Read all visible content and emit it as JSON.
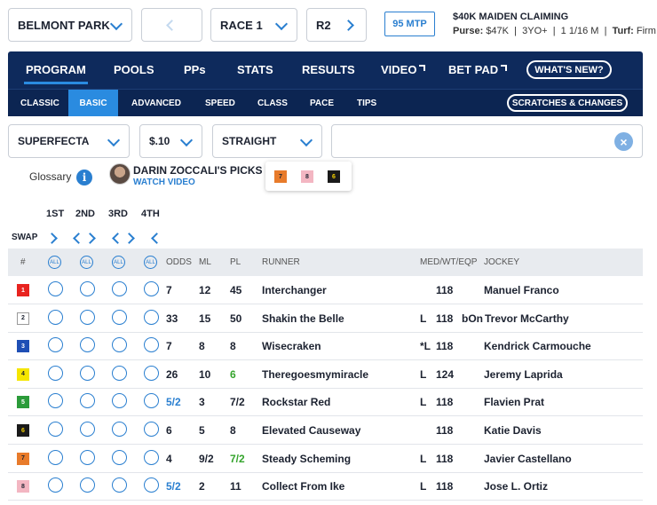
{
  "top": {
    "track": "BELMONT PARK",
    "race": "RACE 1",
    "race_short": "R2",
    "mtp": "95 MTP",
    "race_title": "$40K MAIDEN CLAIMING",
    "purse_label": "Purse:",
    "purse": "$47K",
    "age": "3YO+",
    "distance": "1 1/16 M",
    "turf_label": "Turf:",
    "turf": "Firm",
    "sep": "|"
  },
  "nav": {
    "tabs": [
      "PROGRAM",
      "POOLS",
      "PPs",
      "STATS",
      "RESULTS",
      "VIDEO",
      "BET PAD"
    ],
    "whats_new": "WHAT'S NEW?",
    "subtabs": [
      "CLASSIC",
      "BASIC",
      "ADVANCED",
      "SPEED",
      "CLASS",
      "PACE",
      "TIPS"
    ],
    "active_subtab": "BASIC",
    "scratches": "SCRATCHES & CHANGES"
  },
  "bet": {
    "type": "SUPERFECTA",
    "amount": "$.10",
    "mode": "STRAIGHT",
    "clear": "×"
  },
  "glossary": "Glossary",
  "info_glyph": "i",
  "picks": {
    "title": "DARIN ZOCCALI'S PICKS",
    "watch": "WATCH VIDEO",
    "selections": [
      {
        "num": "7",
        "bg": "#e87b2b",
        "fg": "#1c2230"
      },
      {
        "num": "8",
        "bg": "#f3b6c2",
        "fg": "#1c2230"
      },
      {
        "num": "6",
        "bg": "#1a1a1a",
        "fg": "#f4d000"
      }
    ]
  },
  "positions": [
    "1ST",
    "2ND",
    "3RD",
    "4TH"
  ],
  "swap": "SWAP",
  "table": {
    "headers": {
      "num": "#",
      "odds": "ODDS",
      "ml": "ML",
      "pl": "PL",
      "runner": "RUNNER",
      "med": "MED/WT/EQP",
      "jockey": "JOCKEY"
    },
    "all_label": "ALL",
    "rows": [
      {
        "num": "1",
        "bg": "#e8231f",
        "fg": "#ffffff",
        "border": "#e8231f",
        "odds": "7",
        "odds_blue": false,
        "ml": "12",
        "pl": "45",
        "pl_green": false,
        "runner": "Interchanger",
        "med": "",
        "wt": "118",
        "eqp": "",
        "jockey": "Manuel Franco"
      },
      {
        "num": "2",
        "bg": "#ffffff",
        "fg": "#1c2230",
        "border": "#999999",
        "odds": "33",
        "odds_blue": false,
        "ml": "15",
        "pl": "50",
        "pl_green": false,
        "runner": "Shakin the Belle",
        "med": "L",
        "wt": "118",
        "eqp": "bOn",
        "jockey": "Trevor McCarthy"
      },
      {
        "num": "3",
        "bg": "#1f4fb5",
        "fg": "#ffffff",
        "border": "#1f4fb5",
        "odds": "7",
        "odds_blue": false,
        "ml": "8",
        "pl": "8",
        "pl_green": false,
        "runner": "Wisecraken",
        "med": "*L",
        "wt": "118",
        "eqp": "",
        "jockey": "Kendrick Carmouche"
      },
      {
        "num": "4",
        "bg": "#f5e600",
        "fg": "#1c2230",
        "border": "#f5e600",
        "odds": "26",
        "odds_blue": false,
        "ml": "10",
        "pl": "6",
        "pl_green": true,
        "runner": "Theregoesmymiracle",
        "med": "L",
        "wt": "124",
        "eqp": "",
        "jockey": "Jeremy Laprida"
      },
      {
        "num": "5",
        "bg": "#2b9b3a",
        "fg": "#ffffff",
        "border": "#2b9b3a",
        "odds": "5/2",
        "odds_blue": true,
        "ml": "3",
        "pl": "7/2",
        "pl_green": false,
        "runner": "Rockstar Red",
        "med": "L",
        "wt": "118",
        "eqp": "",
        "jockey": "Flavien Prat"
      },
      {
        "num": "6",
        "bg": "#1a1a1a",
        "fg": "#f4d000",
        "border": "#1a1a1a",
        "odds": "6",
        "odds_blue": false,
        "ml": "5",
        "pl": "8",
        "pl_green": false,
        "runner": "Elevated Causeway",
        "med": "",
        "wt": "118",
        "eqp": "",
        "jockey": "Katie Davis"
      },
      {
        "num": "7",
        "bg": "#e87b2b",
        "fg": "#1c2230",
        "border": "#e87b2b",
        "odds": "4",
        "odds_blue": false,
        "ml": "9/2",
        "pl": "7/2",
        "pl_green": true,
        "runner": "Steady Scheming",
        "med": "L",
        "wt": "118",
        "eqp": "",
        "jockey": "Javier Castellano"
      },
      {
        "num": "8",
        "bg": "#f3b6c2",
        "fg": "#1c2230",
        "border": "#f3b6c2",
        "odds": "5/2",
        "odds_blue": true,
        "ml": "2",
        "pl": "11",
        "pl_green": false,
        "runner": "Collect From Ike",
        "med": "L",
        "wt": "118",
        "eqp": "",
        "jockey": "Jose L. Ortiz"
      }
    ]
  }
}
